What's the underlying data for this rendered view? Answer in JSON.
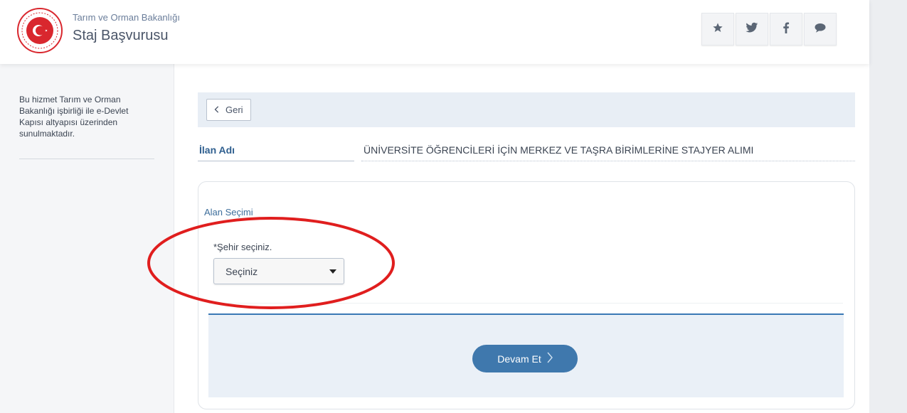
{
  "header": {
    "ministry_name": "Tarım ve Orman Bakanlığı",
    "service_title": "Staj Başvurusu",
    "buttons": [
      {
        "icon": "star-icon"
      },
      {
        "icon": "twitter-icon"
      },
      {
        "icon": "facebook-icon"
      },
      {
        "icon": "chat-icon"
      }
    ]
  },
  "sidebar": {
    "description": "Bu hizmet Tarım ve Orman Bakanlığı işbirliği ile e-Devlet Kapısı altyapısı üzerinden sunulmaktadır."
  },
  "main": {
    "back_label": "Geri",
    "ilan_label": "İlan Adı",
    "ilan_value": "ÜNİVERSİTE ÖĞRENCİLERİ İÇİN MERKEZ VE TAŞRA BİRİMLERİNE STAJYER ALIMI",
    "section_title": "Alan Seçimi",
    "city_label": "*Şehir seçiniz.",
    "city_select_value": "Seçiniz",
    "continue_label": "Devam Et"
  },
  "colors": {
    "accent": "#3f78ad",
    "annotation": "#e01e1e",
    "panel": "#eaf0f7"
  }
}
